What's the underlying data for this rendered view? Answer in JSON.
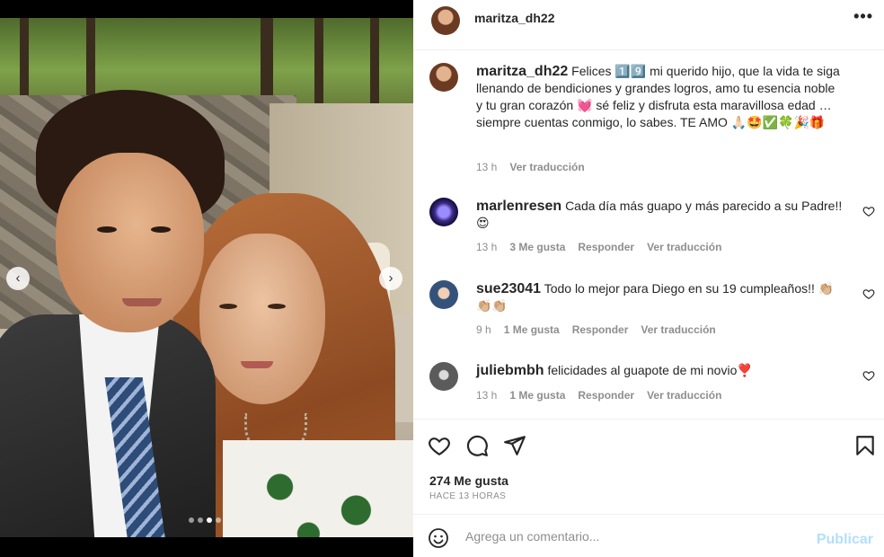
{
  "header": {
    "username": "maritza_dh22",
    "more_icon": "more-horizontal-icon",
    "more_glyph": "•••"
  },
  "photo": {
    "prev_icon": "chevron-left-icon",
    "next_icon": "chevron-right-icon",
    "prev_glyph": "‹",
    "next_glyph": "›",
    "slide_count": 4,
    "active_slide": 2
  },
  "caption": {
    "username": "maritza_dh22",
    "text": "Felices 1️⃣9️⃣ mi querido hijo, que la vida te siga llenando de bendiciones y grandes logros, amo tu esencia noble y tu gran corazón 💓 sé feliz y disfruta esta maravillosa edad … siempre cuentas conmigo, lo sabes. TE AMO 🙏🏻🤩✅🍀🎉🎁",
    "time": "13 h",
    "translate": "Ver traducción"
  },
  "comments": [
    {
      "username": "marlenresen",
      "text": "Cada día más guapo y más parecido a su Padre!! 😍",
      "time": "13 h",
      "likes": "3 Me gusta",
      "reply": "Responder",
      "translate": "Ver traducción"
    },
    {
      "username": "sue23041",
      "text": "Todo lo mejor para Diego en su 19 cumpleaños!! 👏🏼👏🏼👏🏼",
      "time": "9 h",
      "likes": "1 Me gusta",
      "reply": "Responder",
      "translate": "Ver traducción"
    },
    {
      "username": "juliebmbh",
      "text": "felicidades al guapote de mi novio❣️",
      "time": "13 h",
      "likes": "1 Me gusta",
      "reply": "Responder",
      "translate": "Ver traducción"
    }
  ],
  "actions": {
    "like_icon": "heart-icon",
    "comment_icon": "comment-icon",
    "share_icon": "send-icon",
    "save_icon": "bookmark-icon",
    "likes_count": "274 Me gusta",
    "posted_ago": "HACE 13 HORAS"
  },
  "composer": {
    "emoji_icon": "emoji-icon",
    "placeholder": "Agrega un comentario...",
    "publish_label": "Publicar"
  }
}
